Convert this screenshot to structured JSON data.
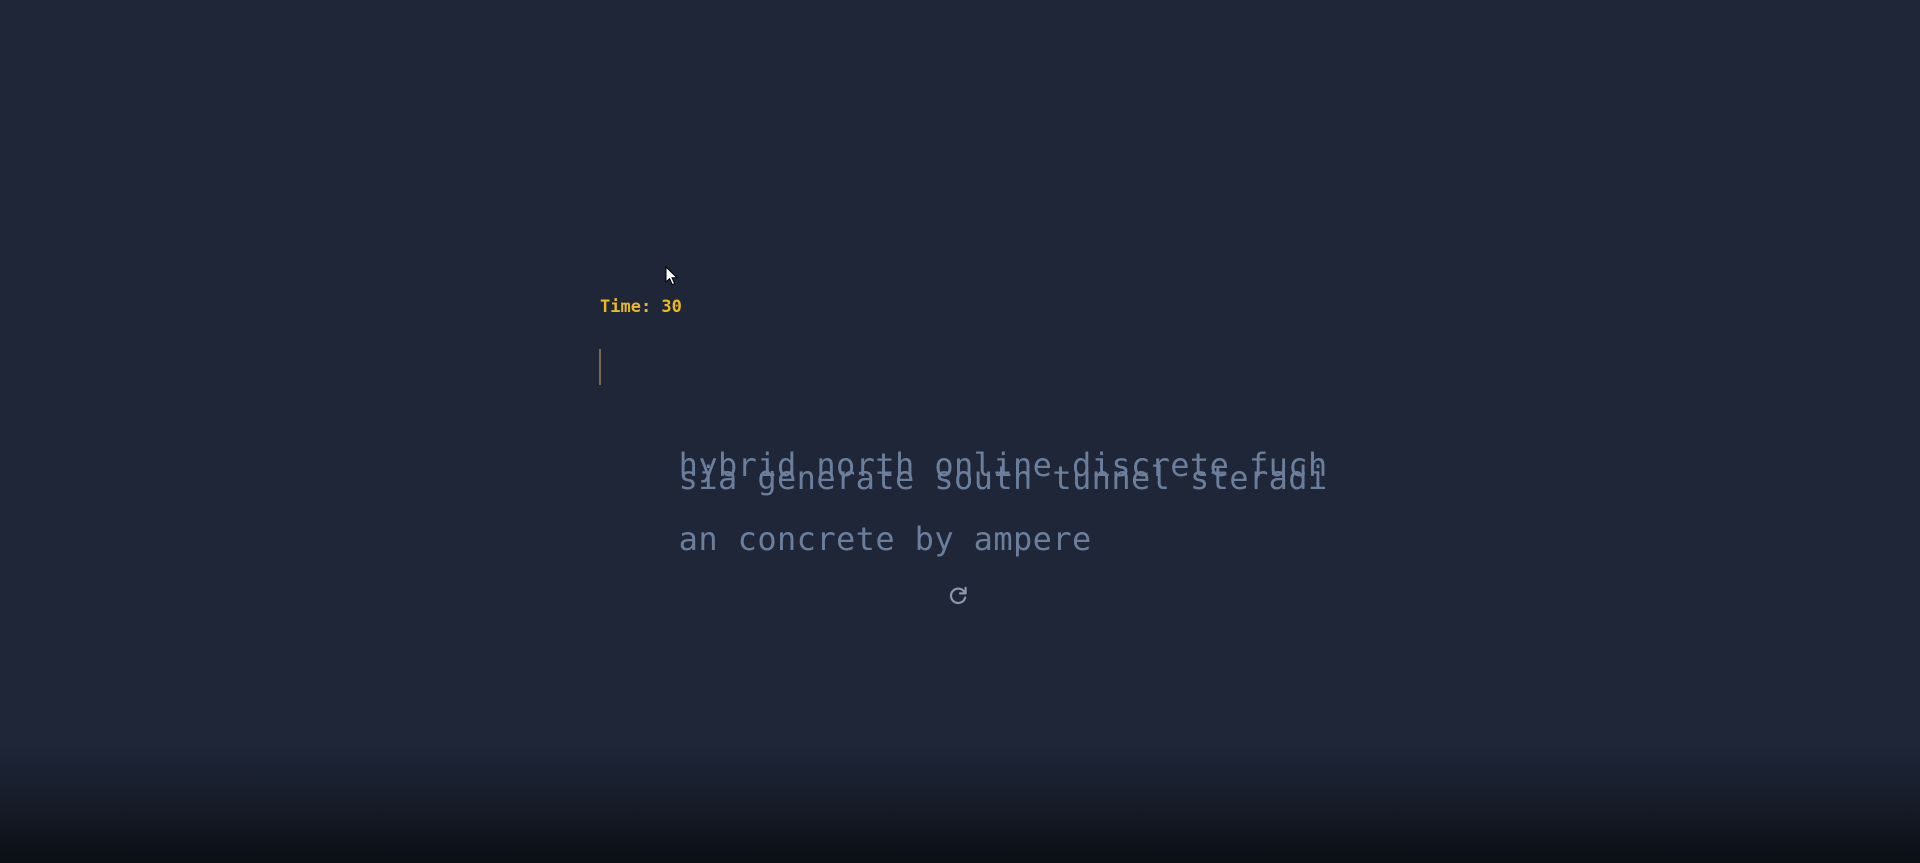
{
  "timer": {
    "label": "Time: 30"
  },
  "words": {
    "lines": [
      "hybrid north online discrete fuch",
      "sia generate south tunnel steradi",
      "an concrete by ampere"
    ]
  },
  "icons": {
    "restart": "refresh-icon",
    "cursor": "mouse-pointer-icon"
  },
  "colors": {
    "background": "#1e2638",
    "timer": "#e8b923",
    "words": "#6b7e9c",
    "caret": "#7a6a4f"
  }
}
